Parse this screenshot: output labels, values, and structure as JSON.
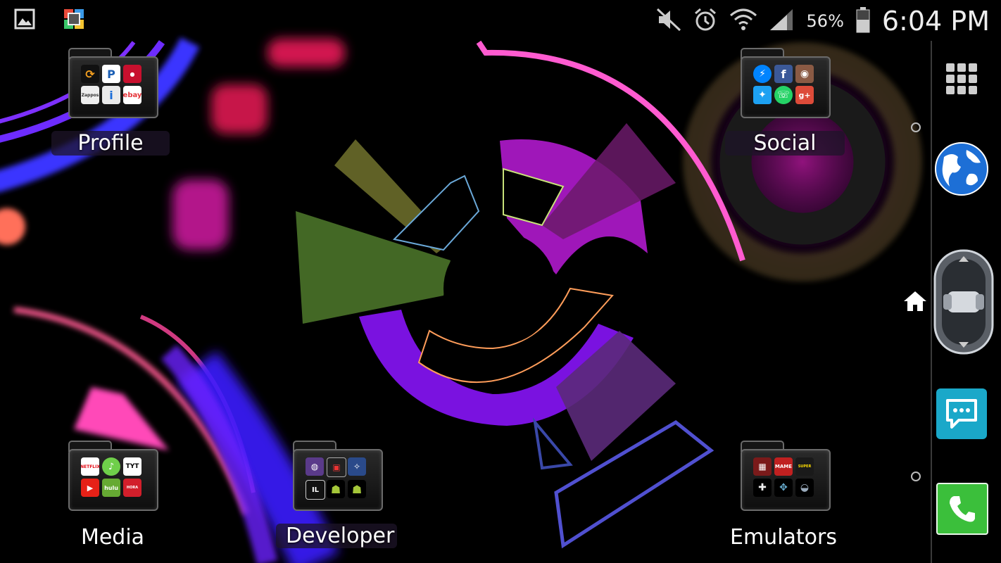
{
  "status_bar": {
    "battery_percent": "56%",
    "time": "6:04 PM",
    "left_icons": [
      "gallery-icon",
      "multicolor-app-icon"
    ],
    "right_icons": [
      "mute-icon",
      "alarm-icon",
      "wifi-icon",
      "signal-icon",
      "battery-icon"
    ]
  },
  "folders": [
    {
      "id": "profile",
      "label": "Profile",
      "apps": [
        "sync",
        "P",
        "Corriere",
        "Zappos",
        "i",
        "ebay"
      ]
    },
    {
      "id": "social",
      "label": "Social",
      "apps": [
        "messenger",
        "facebook",
        "instagram",
        "twitter",
        "whatsapp",
        "g+"
      ]
    },
    {
      "id": "media",
      "label": "Media",
      "apps": [
        "NETFLIX",
        "music",
        "TYT",
        "youtube",
        "hulu",
        "PRIMERA HORA"
      ]
    },
    {
      "id": "developer",
      "label": "Developer",
      "apps": [
        "app1",
        "app2",
        "app3",
        "IL",
        "android",
        "android"
      ]
    },
    {
      "id": "emulators",
      "label": "Emulators",
      "apps": [
        "arcade",
        "MAME",
        "SUPER RETRO",
        "gamepad",
        "playstation",
        "controller"
      ]
    }
  ],
  "dock": {
    "items": [
      "app-drawer",
      "browser",
      "home-scroller",
      "messaging",
      "phone"
    ]
  },
  "colors": {
    "accent_purple": "#9b2cff",
    "accent_magenta": "#e01ad0",
    "accent_green": "#5a8a2a"
  }
}
